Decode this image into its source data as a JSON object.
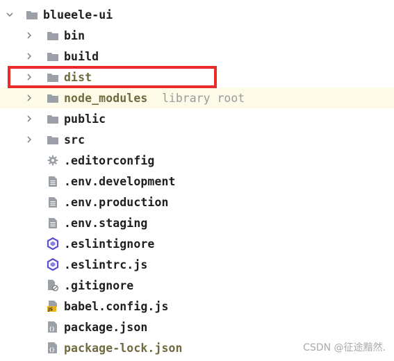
{
  "tree": {
    "root": {
      "label": "blueele-ui",
      "icon": "folder-icon",
      "expanded": true
    },
    "folders": [
      {
        "label": "bin"
      },
      {
        "label": "build"
      },
      {
        "label": "dist"
      },
      {
        "label": "node_modules",
        "suffix": "library root"
      },
      {
        "label": "public"
      },
      {
        "label": "src"
      }
    ],
    "files": [
      {
        "label": ".editorconfig",
        "icon": "gear-icon"
      },
      {
        "label": ".env.development",
        "icon": "text-file-icon"
      },
      {
        "label": ".env.production",
        "icon": "text-file-icon"
      },
      {
        "label": ".env.staging",
        "icon": "text-file-icon"
      },
      {
        "label": ".eslintignore",
        "icon": "eslint-icon"
      },
      {
        "label": ".eslintrc.js",
        "icon": "eslint-icon"
      },
      {
        "label": ".gitignore",
        "icon": "ignore-file-icon"
      },
      {
        "label": "babel.config.js",
        "icon": "js-file-icon"
      },
      {
        "label": "package.json",
        "icon": "json-file-icon"
      },
      {
        "label": "package-lock.json",
        "icon": "json-file-icon"
      }
    ]
  },
  "highlighted_item": "dist",
  "watermark": "CSDN @征途黯然.",
  "colors": {
    "highlight_border": "#ea2b2b",
    "excluded_row_bg": "#fdfbe8",
    "folder": "#9aa0a6",
    "eslint": "#5a4fcf",
    "muted_text": "#6f6a3f"
  }
}
